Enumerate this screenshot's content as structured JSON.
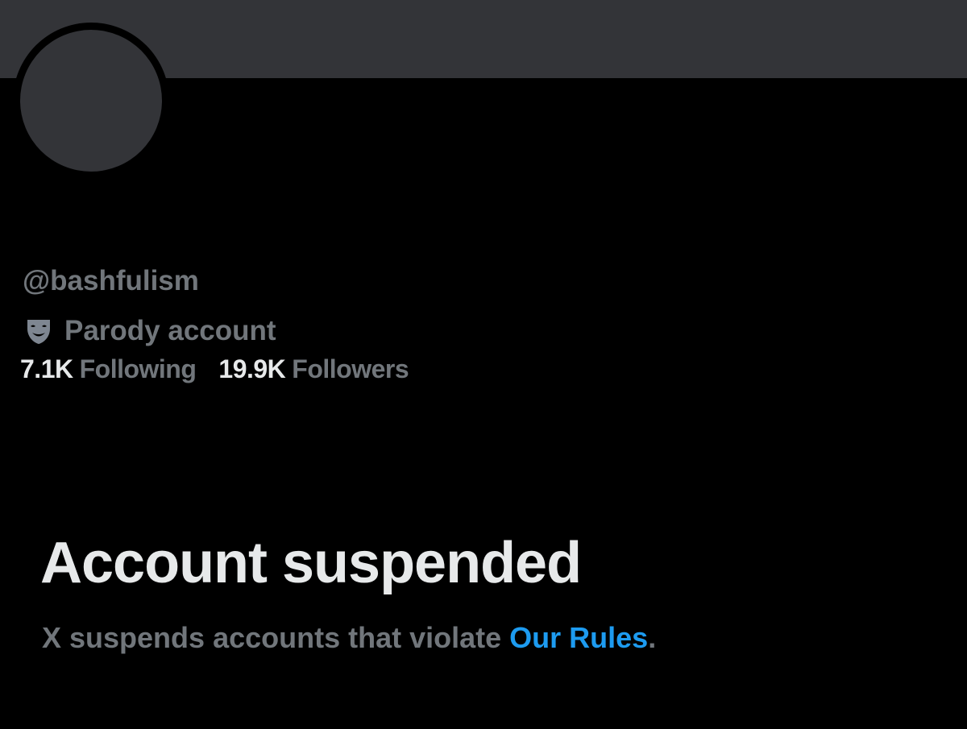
{
  "profile": {
    "handle": "@bashfulism",
    "label_icon": "theater-mask-icon",
    "label_text": "Parody account",
    "following_count": "7.1K",
    "following_label": "Following",
    "followers_count": "19.9K",
    "followers_label": "Followers"
  },
  "suspension": {
    "title": "Account suspended",
    "message_prefix": "X suspends accounts that violate ",
    "rules_link": "Our Rules",
    "message_suffix": "."
  },
  "colors": {
    "background": "#000000",
    "banner": "#333438",
    "primary_text": "#e7e9ea",
    "secondary_text": "#71767b",
    "link": "#1d9bf0"
  }
}
